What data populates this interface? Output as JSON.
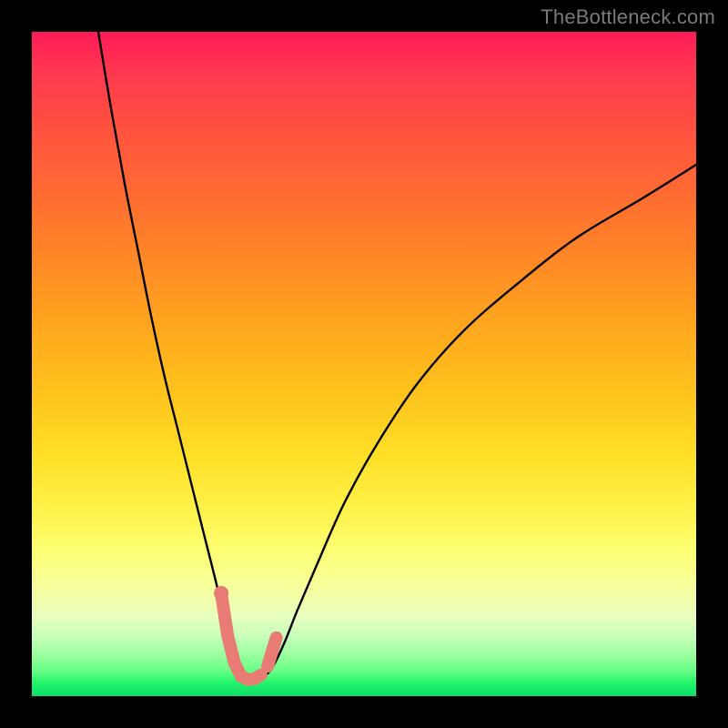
{
  "watermark": "TheBottleneck.com",
  "chart_data": {
    "type": "line",
    "title": "",
    "xlabel": "",
    "ylabel": "",
    "xlim": [
      0,
      100
    ],
    "ylim": [
      0,
      100
    ],
    "series": [
      {
        "name": "curve",
        "color": "#000000",
        "x": [
          10,
          12,
          14,
          16,
          18,
          20,
          22,
          24,
          26,
          28,
          29.5,
          31,
          32.5,
          34,
          36,
          38,
          40,
          43,
          47,
          52,
          58,
          65,
          73,
          82,
          92,
          100
        ],
        "y": [
          100,
          88,
          77,
          67,
          57,
          48,
          40,
          32,
          24,
          16,
          9,
          4,
          2.5,
          2.5,
          4,
          8,
          13,
          20,
          29,
          38,
          47,
          55,
          62,
          69,
          75,
          80
        ]
      },
      {
        "name": "highlight-left",
        "color": "#e87b74",
        "x": [
          28.5,
          29.5,
          30.5,
          31.5
        ],
        "y": [
          15.5,
          9,
          5,
          3
        ]
      },
      {
        "name": "highlight-right",
        "color": "#e87b74",
        "x": [
          35.5,
          36.8
        ],
        "y": [
          4.5,
          8.8
        ]
      },
      {
        "name": "highlight-bottom",
        "color": "#e87b74",
        "x": [
          31.5,
          32.5,
          33.5,
          34.5
        ],
        "y": [
          3,
          2.5,
          2.6,
          3.2
        ]
      }
    ],
    "gradient_stops": [
      {
        "pct": 0,
        "color": "#ff1a58"
      },
      {
        "pct": 50,
        "color": "#ffc21c"
      },
      {
        "pct": 80,
        "color": "#fdff72"
      },
      {
        "pct": 100,
        "color": "#11e068"
      }
    ]
  }
}
